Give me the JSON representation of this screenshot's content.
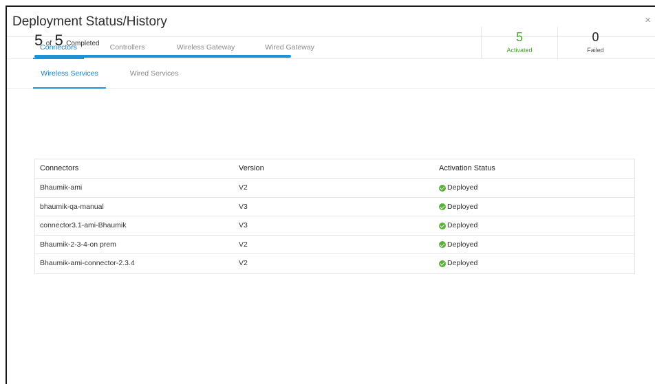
{
  "modal": {
    "title": "Deployment Status/History",
    "close_label": "×"
  },
  "tabs": [
    {
      "label": "Connectors",
      "active": true
    },
    {
      "label": "Controllers",
      "active": false
    },
    {
      "label": "Wireless Gateway",
      "active": false
    },
    {
      "label": "Wired Gateway",
      "active": false
    }
  ],
  "subtabs": [
    {
      "label": "Wireless Services",
      "active": true
    },
    {
      "label": "Wired Services",
      "active": false
    }
  ],
  "summary": {
    "done": "5",
    "of": "of",
    "total": "5",
    "completed_label": "Completed",
    "progress_fraction": 1.0,
    "activated_count": "5",
    "activated_label": "Activated",
    "failed_count": "0",
    "failed_label": "Failed"
  },
  "table": {
    "headers": [
      "Connectors",
      "Version",
      "Activation Status"
    ],
    "rows": [
      {
        "name": "Bhaumik-ami",
        "version": "V2",
        "status": "Deployed"
      },
      {
        "name": "bhaumik-qa-manual",
        "version": "V3",
        "status": "Deployed"
      },
      {
        "name": "connector3.1-ami-Bhaumik",
        "version": "V3",
        "status": "Deployed"
      },
      {
        "name": "Bhaumik-2-3-4-on prem",
        "version": "V2",
        "status": "Deployed"
      },
      {
        "name": "Bhaumik-ami-connector-2.3.4",
        "version": "V2",
        "status": "Deployed"
      }
    ]
  },
  "colors": {
    "accent": "#1b93d6",
    "activated": "#4aa52e",
    "deployed_icon": "#5ab13a"
  },
  "icons": {
    "close": "close-icon",
    "status": "check-circle-icon"
  }
}
